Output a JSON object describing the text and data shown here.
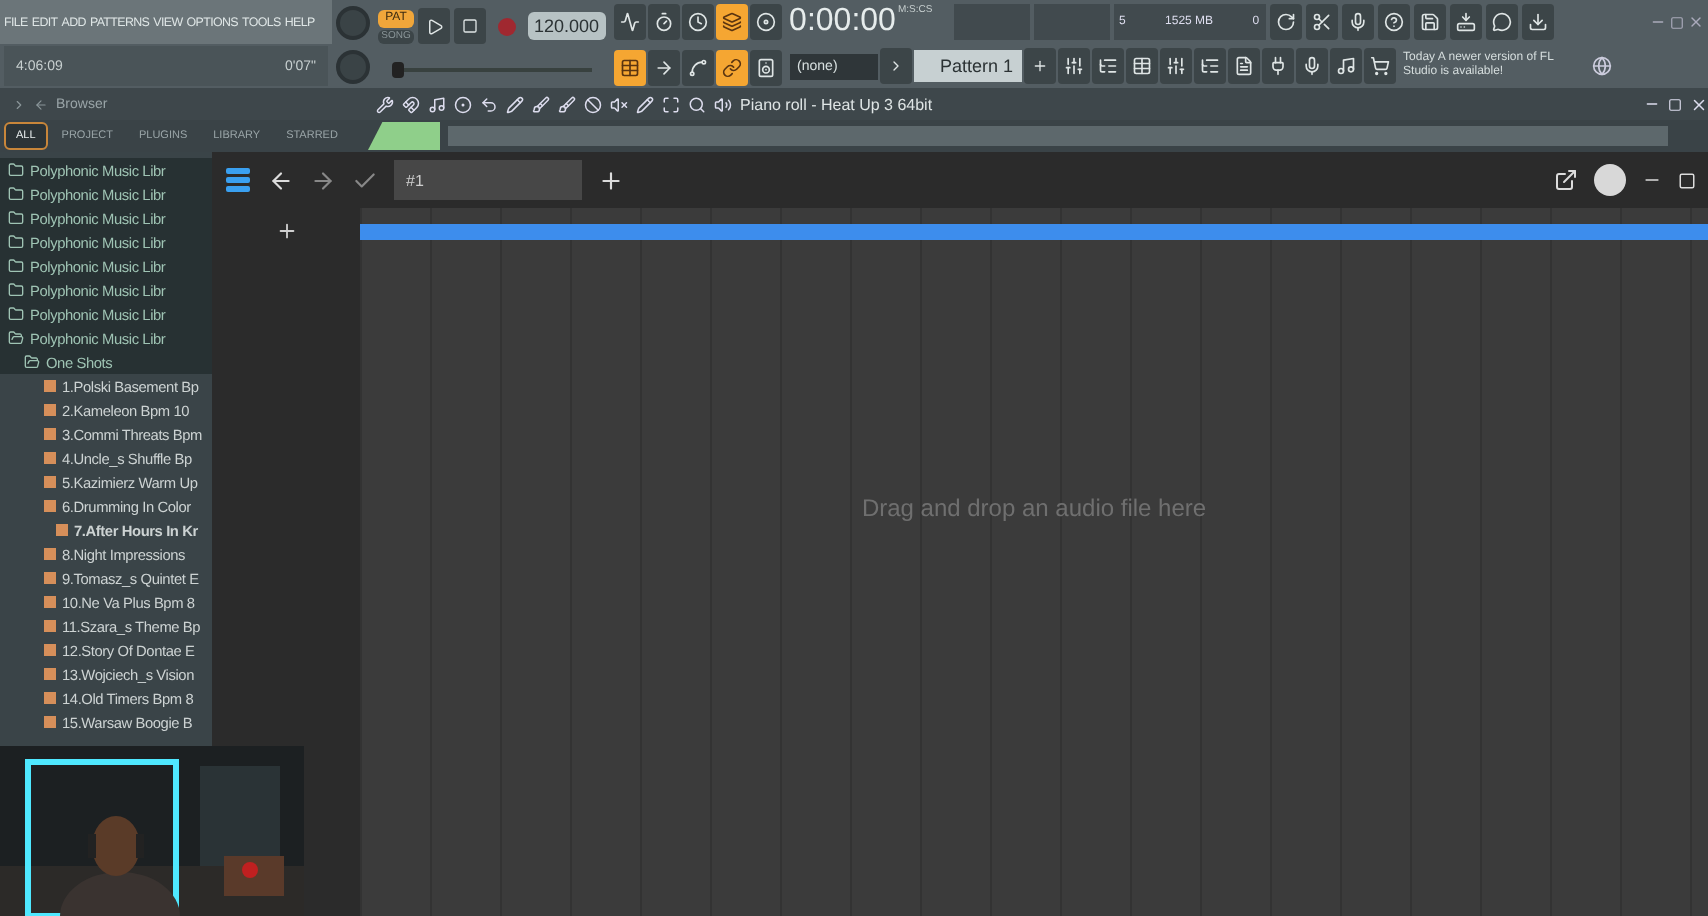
{
  "menu": [
    "FILE",
    "EDIT",
    "ADD",
    "PATTERNS",
    "VIEW",
    "OPTIONS",
    "TOOLS",
    "HELP"
  ],
  "hint_bar": {
    "time": "4:06:09",
    "elapsed": "0'07\""
  },
  "modes": [
    {
      "label": "PAT",
      "selected": true
    },
    {
      "label": "SONG",
      "selected": false
    }
  ],
  "recording": false,
  "tempo": "120.000",
  "toggles_top": [
    {
      "on": false
    },
    {
      "on": false
    },
    {
      "on": false
    },
    {
      "on": true
    },
    {
      "on": false
    }
  ],
  "toggles_bottom": [
    {
      "on": true
    },
    {
      "on": false
    },
    {
      "on": false
    },
    {
      "on": true
    },
    {
      "on": false
    }
  ],
  "clock": {
    "time": "0:00:00",
    "unit": "M:S:CS"
  },
  "monitor": {
    "cores": "5",
    "memory": "1525 MB",
    "polyphony": "0"
  },
  "pattern_picker": "(none)",
  "pattern": "Pattern 1",
  "news": {
    "day": "Today",
    "message": "A newer version of FL Studio is available!"
  },
  "browser": {
    "title": "Browser",
    "tabs": [
      {
        "label": "ALL",
        "selected": true
      },
      {
        "label": "PROJECT",
        "selected": false
      },
      {
        "label": "PLUGINS",
        "selected": false
      },
      {
        "label": "LIBRARY",
        "selected": false
      },
      {
        "label": "STARRED",
        "selected": false
      }
    ],
    "items": [
      {
        "kind": "folder",
        "label": "Polyphonic Music Libr",
        "expanded": false,
        "selected": false
      },
      {
        "kind": "folder",
        "label": "Polyphonic Music Libr",
        "expanded": false,
        "selected": false
      },
      {
        "kind": "folder",
        "label": "Polyphonic Music Libr",
        "expanded": false,
        "selected": false
      },
      {
        "kind": "folder",
        "label": "Polyphonic Music Libr",
        "expanded": false,
        "selected": false
      },
      {
        "kind": "folder",
        "label": "Polyphonic Music Libr",
        "expanded": false,
        "selected": false
      },
      {
        "kind": "folder",
        "label": "Polyphonic Music Libr",
        "expanded": false,
        "selected": false
      },
      {
        "kind": "folder",
        "label": "Polyphonic Music Libr",
        "expanded": false,
        "selected": false
      },
      {
        "kind": "folder",
        "label": "Polyphonic Music Libr",
        "expanded": true,
        "selected": false,
        "children": [
          {
            "kind": "folder",
            "label": "One Shots",
            "expanded": true,
            "selected": false,
            "children": [
              {
                "kind": "file",
                "label": "1.Polski Basement Bp",
                "selected": false
              },
              {
                "kind": "file",
                "label": "2.Kameleon Bpm 10",
                "selected": false
              },
              {
                "kind": "file",
                "label": "3.Commi Threats Bpm",
                "selected": false
              },
              {
                "kind": "file",
                "label": "4.Uncle_s Shuffle Bp",
                "selected": false
              },
              {
                "kind": "file",
                "label": "5.Kazimierz Warm Up",
                "selected": false
              },
              {
                "kind": "file",
                "label": "6.Drumming In Color",
                "selected": false
              },
              {
                "kind": "file",
                "label": "7.After Hours In Kr",
                "selected": true
              },
              {
                "kind": "file",
                "label": "8.Night Impressions",
                "selected": false
              },
              {
                "kind": "file",
                "label": "9.Tomasz_s Quintet E",
                "selected": false
              },
              {
                "kind": "file",
                "label": "10.Ne Va Plus Bpm 8",
                "selected": false
              },
              {
                "kind": "file",
                "label": "11.Szara_s Theme Bp",
                "selected": false
              },
              {
                "kind": "file",
                "label": "12.Story Of Dontae E",
                "selected": false
              },
              {
                "kind": "file",
                "label": "13.Wojciech_s Vision",
                "selected": false
              },
              {
                "kind": "file",
                "label": "14.Old Timers Bpm 8",
                "selected": false
              },
              {
                "kind": "file",
                "label": "15.Warsaw Boogie B",
                "selected": false
              }
            ]
          }
        ]
      }
    ]
  },
  "piano_roll": {
    "title": "Piano roll - Heat Up 3 64bit"
  },
  "editor": {
    "tabs": [
      {
        "label": "#1",
        "selected": true
      }
    ],
    "drop_hint": "Drag and drop an audio file here"
  }
}
